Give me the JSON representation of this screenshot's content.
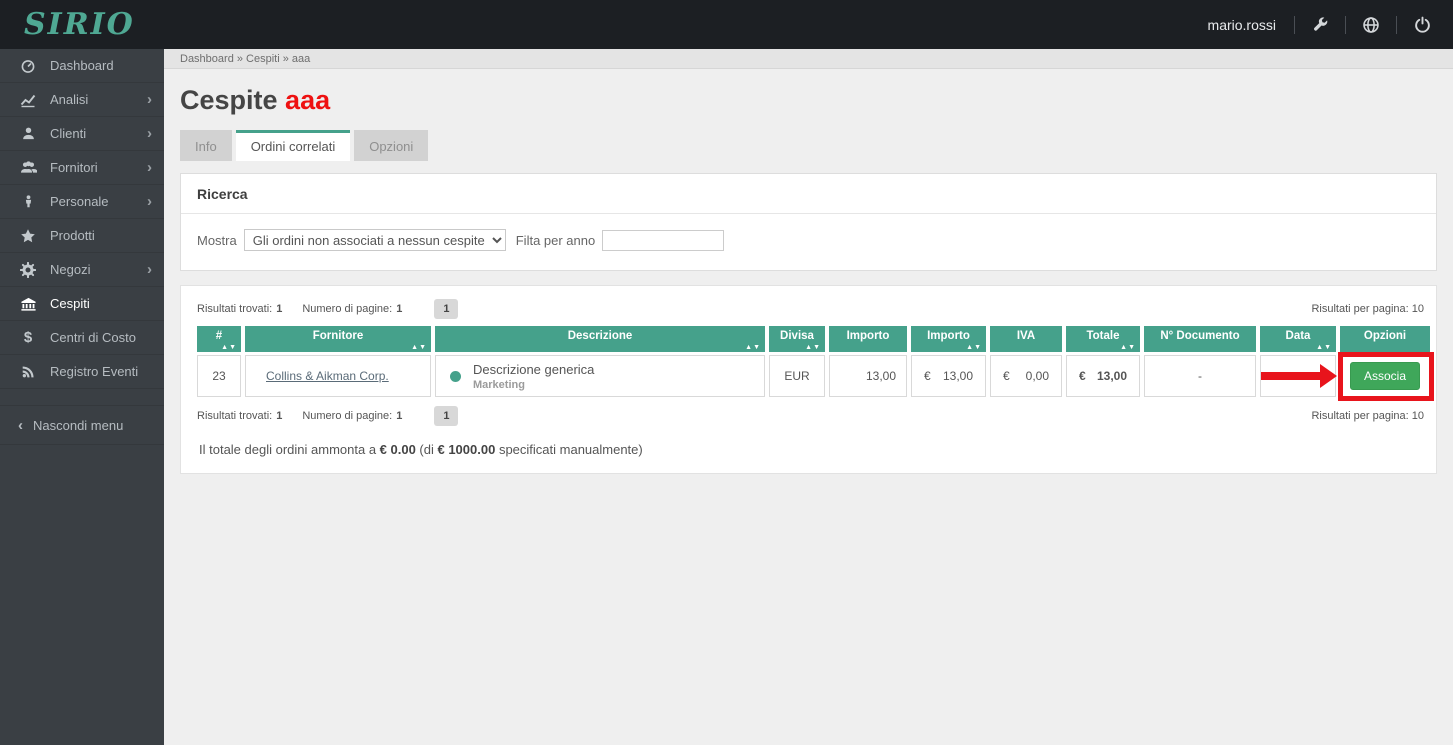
{
  "colors": {
    "accent_teal": "#45a18b",
    "topbar_bg": "#1c1f23",
    "sidebar_bg": "#3a3f44",
    "title_highlight_red": "#ee1111",
    "annotation_red": "#e8141c",
    "button_green": "#3fa75a"
  },
  "topbar": {
    "logo": "SIRIO",
    "username": "mario.rossi",
    "icons": [
      "wrench-icon",
      "globe-icon",
      "power-icon"
    ]
  },
  "sidebar": {
    "items": [
      {
        "label": "Dashboard"
      },
      {
        "label": "Analisi"
      },
      {
        "label": "Clienti"
      },
      {
        "label": "Fornitori"
      },
      {
        "label": "Personale"
      },
      {
        "label": "Prodotti"
      },
      {
        "label": "Negozi"
      },
      {
        "label": "Cespiti"
      },
      {
        "label": "Centri di Costo"
      },
      {
        "label": "Registro Eventi"
      }
    ],
    "chevron_glyph": "›",
    "collapse_chevron": "‹",
    "collapse_label": "Nascondi menu",
    "dollar_glyph": "$"
  },
  "breadcrumb": "Dashboard » Cespiti » aaa",
  "page": {
    "title_prefix": "Cespite ",
    "title_highlight": "aaa"
  },
  "tabs": [
    {
      "label": "Info"
    },
    {
      "label": "Ordini correlati"
    },
    {
      "label": "Opzioni"
    }
  ],
  "search": {
    "heading": "Ricerca",
    "mostra_label": "Mostra",
    "select_value": "Gli ordini non associati a nessun cespite",
    "year_label": "Filta per anno",
    "year_value": ""
  },
  "results": {
    "found_label": "Risultati trovati:",
    "found_value": "1",
    "pages_label": "Numero di pagine:",
    "pages_value": "1",
    "page_button": "1",
    "per_page_label": "Risultati per pagina:",
    "per_page_value": "10",
    "table": {
      "sort_glyph": "▲▼",
      "columns": [
        {
          "label": "#"
        },
        {
          "label": "Fornitore"
        },
        {
          "label": "Descrizione"
        },
        {
          "label": "Divisa"
        },
        {
          "label": "Importo"
        },
        {
          "label": "Importo"
        },
        {
          "label": "IVA"
        },
        {
          "label": "Totale"
        },
        {
          "label": "N° Documento"
        },
        {
          "label": "Data"
        },
        {
          "label": "Opzioni"
        }
      ],
      "row": {
        "id": "23",
        "fornitore": "Collins & Aikman Corp.",
        "descrizione": "Descrizione generica",
        "categoria": "Marketing",
        "divisa": "EUR",
        "importo_divisa": "13,00",
        "eur_symbol": "€",
        "importo_eur": "13,00",
        "iva": "0,00",
        "totale": "13,00",
        "documento": "-",
        "azione": "Associa"
      }
    },
    "totals": {
      "prefix": "Il totale degli ordini ammonta a ",
      "value": "€ 0.00",
      "mid": " (di ",
      "manual_value": "€ 1000.00",
      "suffix": " specificati manualmente)"
    }
  }
}
